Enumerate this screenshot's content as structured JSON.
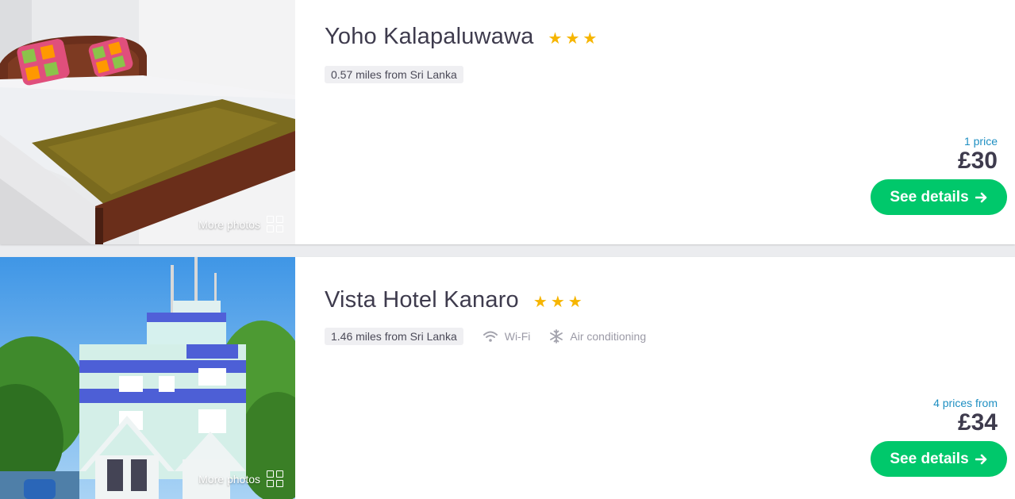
{
  "colors": {
    "accent_green": "#00c86b",
    "star_yellow": "#f6b500",
    "price_note_blue": "#1e8fc2",
    "title_text": "#3e3b4d"
  },
  "hotels": [
    {
      "name": "Yoho Kalapaluwawa",
      "stars": 3,
      "star_glyph": "★",
      "distance": "0.57 miles from Sri Lanka",
      "amenities": [],
      "price_note": "1 price",
      "price": "£30",
      "more_photos": "More photos",
      "cta": "See details",
      "cta_icon": "arrow-right-icon",
      "photo_icon": "bedroom-photo"
    },
    {
      "name": "Vista Hotel Kanaro",
      "stars": 3,
      "star_glyph": "★",
      "distance": "1.46 miles from Sri Lanka",
      "amenities": [
        {
          "label": "Wi-Fi",
          "icon": "wifi-icon"
        },
        {
          "label": "Air conditioning",
          "icon": "snowflake-icon"
        }
      ],
      "price_note": "4 prices from",
      "price": "£34",
      "more_photos": "More photos",
      "cta": "See details",
      "cta_icon": "arrow-right-icon",
      "photo_icon": "building-photo"
    }
  ]
}
